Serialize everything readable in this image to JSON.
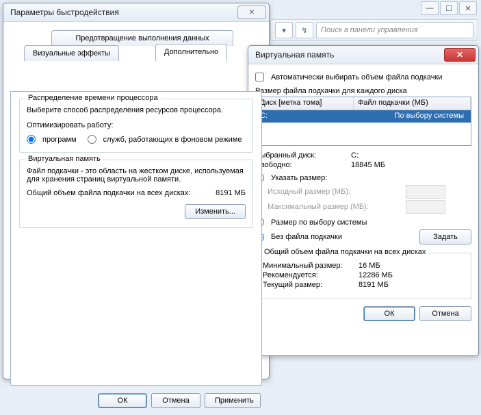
{
  "topSearchPlaceholder": "Поиск в панели управления",
  "perf": {
    "title": "Параметры быстродействия",
    "tabs": {
      "dep": "Предотвращение выполнения данных",
      "visual": "Визуальные эффекты",
      "advanced": "Дополнительно"
    },
    "sched": {
      "title": "Распределение времени процессора",
      "desc": "Выберите способ распределения ресурсов процессора.",
      "optimize": "Оптимизировать работу:",
      "programs": "программ",
      "services": "служб, работающих в фоновом режиме"
    },
    "vm": {
      "title": "Виртуальная память",
      "desc": "Файл подкачки - это область на жестком диске, используемая для хранения страниц виртуальной памяти.",
      "totalLabel": "Общий объем файла подкачки на всех дисках:",
      "totalValue": "8191 МБ",
      "changeBtn": "Изменить..."
    },
    "ok": "ОК",
    "cancel": "Отмена",
    "apply": "Применить"
  },
  "vmDlg": {
    "title": "Виртуальная память",
    "auto": "Автоматически выбирать объем файла подкачки",
    "perDrive": "Размер файла подкачки для каждого диска",
    "colDrive": "Диск [метка тома]",
    "colFile": "Файл подкачки (МБ)",
    "rowDrive": "C:",
    "rowFile": "По выбору системы",
    "selDriveLabel": "Выбранный диск:",
    "selDriveVal": "C:",
    "freeLabel": "Свободно:",
    "freeVal": "18845 МБ",
    "custom": "Указать размер:",
    "initLabel": "Исходный размер (МБ):",
    "maxLabel": "Максимальный размер (МБ):",
    "system": "Размер по выбору системы",
    "none": "Без файла подкачки",
    "setBtn": "Задать",
    "totalsTitle": "Общий объем файла подкачки на всех дисках",
    "minLabel": "Минимальный размер:",
    "minVal": "16 МБ",
    "recLabel": "Рекомендуется:",
    "recVal": "12286 МБ",
    "curLabel": "Текущий размер:",
    "curVal": "8191 МБ",
    "ok": "ОК",
    "cancel": "Отмена"
  }
}
